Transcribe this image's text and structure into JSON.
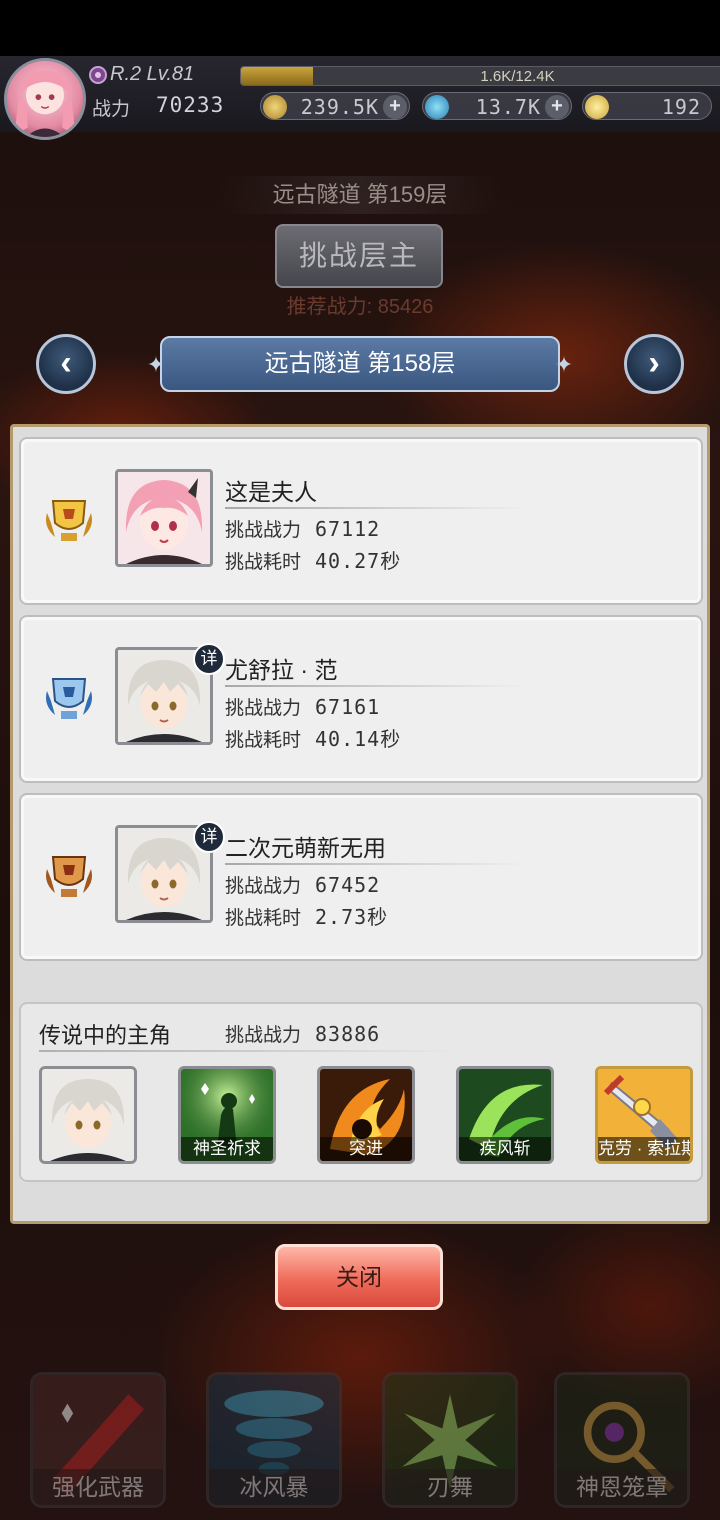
{
  "header": {
    "level_text": "R.2 Lv.81",
    "xp_text": "1.6K/12.4K",
    "xp_fraction": 0.13,
    "power_label": "战力",
    "power_value": "70233",
    "gold": "239.5K",
    "crystal": "13.7K",
    "gem": "192"
  },
  "floor": {
    "next_floor": "远古隧道  第159层",
    "challenge_boss": "挑战层主",
    "recommended_power": "推荐战力: 85426",
    "current_floor": "远古隧道 第158层"
  },
  "entries": [
    {
      "medal": "gold-medal-icon",
      "name": "这是夫人",
      "power_label": "挑战战力",
      "power": "67112",
      "time_label": "挑战耗时",
      "time": "40.27秒",
      "has_detail": false
    },
    {
      "medal": "silver-medal-icon",
      "name": "尤舒拉 · 范",
      "power_label": "挑战战力",
      "power": "67161",
      "time_label": "挑战耗时",
      "time": "40.14秒",
      "has_detail": true,
      "detail_label": "详"
    },
    {
      "medal": "bronze-medal-icon",
      "name": "二次元萌新无用",
      "power_label": "挑战战力",
      "power": "67452",
      "time_label": "挑战耗时",
      "time": "2.73秒",
      "has_detail": true,
      "detail_label": "详"
    }
  ],
  "legend": {
    "title": "传说中的主角",
    "power_label": "挑战战力",
    "power": "83886",
    "slots": [
      "",
      "神圣祈求",
      "突进",
      "疾风斩",
      "克劳 · 索拉斯"
    ]
  },
  "close_label": "关闭",
  "skills": [
    "强化武器",
    "冰风暴",
    "刃舞",
    "神恩笼罩"
  ],
  "colors": {
    "banner_blue": "#3a5780",
    "panel_bg": "#dcdcdc",
    "close_red": "#ef6b5a"
  }
}
